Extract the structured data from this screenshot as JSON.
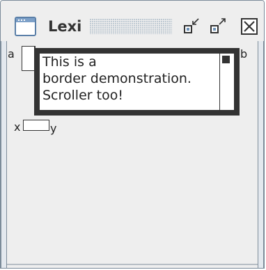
{
  "window": {
    "title": "Lexi",
    "buttons": {
      "iconify": "iconify-icon",
      "maximize": "maximize-icon",
      "close": "close-icon"
    }
  },
  "content": {
    "label_a": "a",
    "label_b": "b",
    "label_x": "x",
    "label_y": "y",
    "border_text": {
      "line1": "This is a",
      "line2": "border demonstration.",
      "line3": "Scroller too!"
    }
  },
  "colors": {
    "frame": "#7d8c99",
    "background": "#eeeeee",
    "border": "#333333",
    "text": "#222222"
  }
}
